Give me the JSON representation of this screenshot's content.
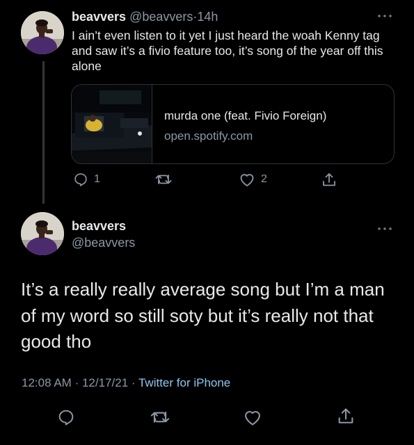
{
  "reply_tweet": {
    "display_name": "beavvers",
    "handle": "@beavvers",
    "separator": "·",
    "time_ago": "14h",
    "text": "I ain’t even listen to it yet I just heard the woah Kenny tag and saw it’s a fivio feature too, it’s song of the year off this alone",
    "card": {
      "title": "murda one (feat. Fivio Foreign)",
      "domain": "open.spotify.com"
    },
    "actions": {
      "reply_count": "1",
      "retweet_count": "",
      "like_count": "2"
    }
  },
  "main_tweet": {
    "display_name": "beavvers",
    "handle": "@beavvers",
    "text": "It’s a really really average song but I’m a man of my word so still soty but it’s really not that good tho",
    "time": "12:08 AM",
    "date": "12/17/21",
    "separator": "·",
    "source": "Twitter for iPhone"
  },
  "icons": [
    "more-icon",
    "reply-icon",
    "retweet-icon",
    "like-icon",
    "share-icon"
  ],
  "colors": {
    "background": "#000000",
    "text": "#e7e9ea",
    "muted": "#8b98a5",
    "link": "#8ec6f0",
    "border": "#2f3336"
  }
}
